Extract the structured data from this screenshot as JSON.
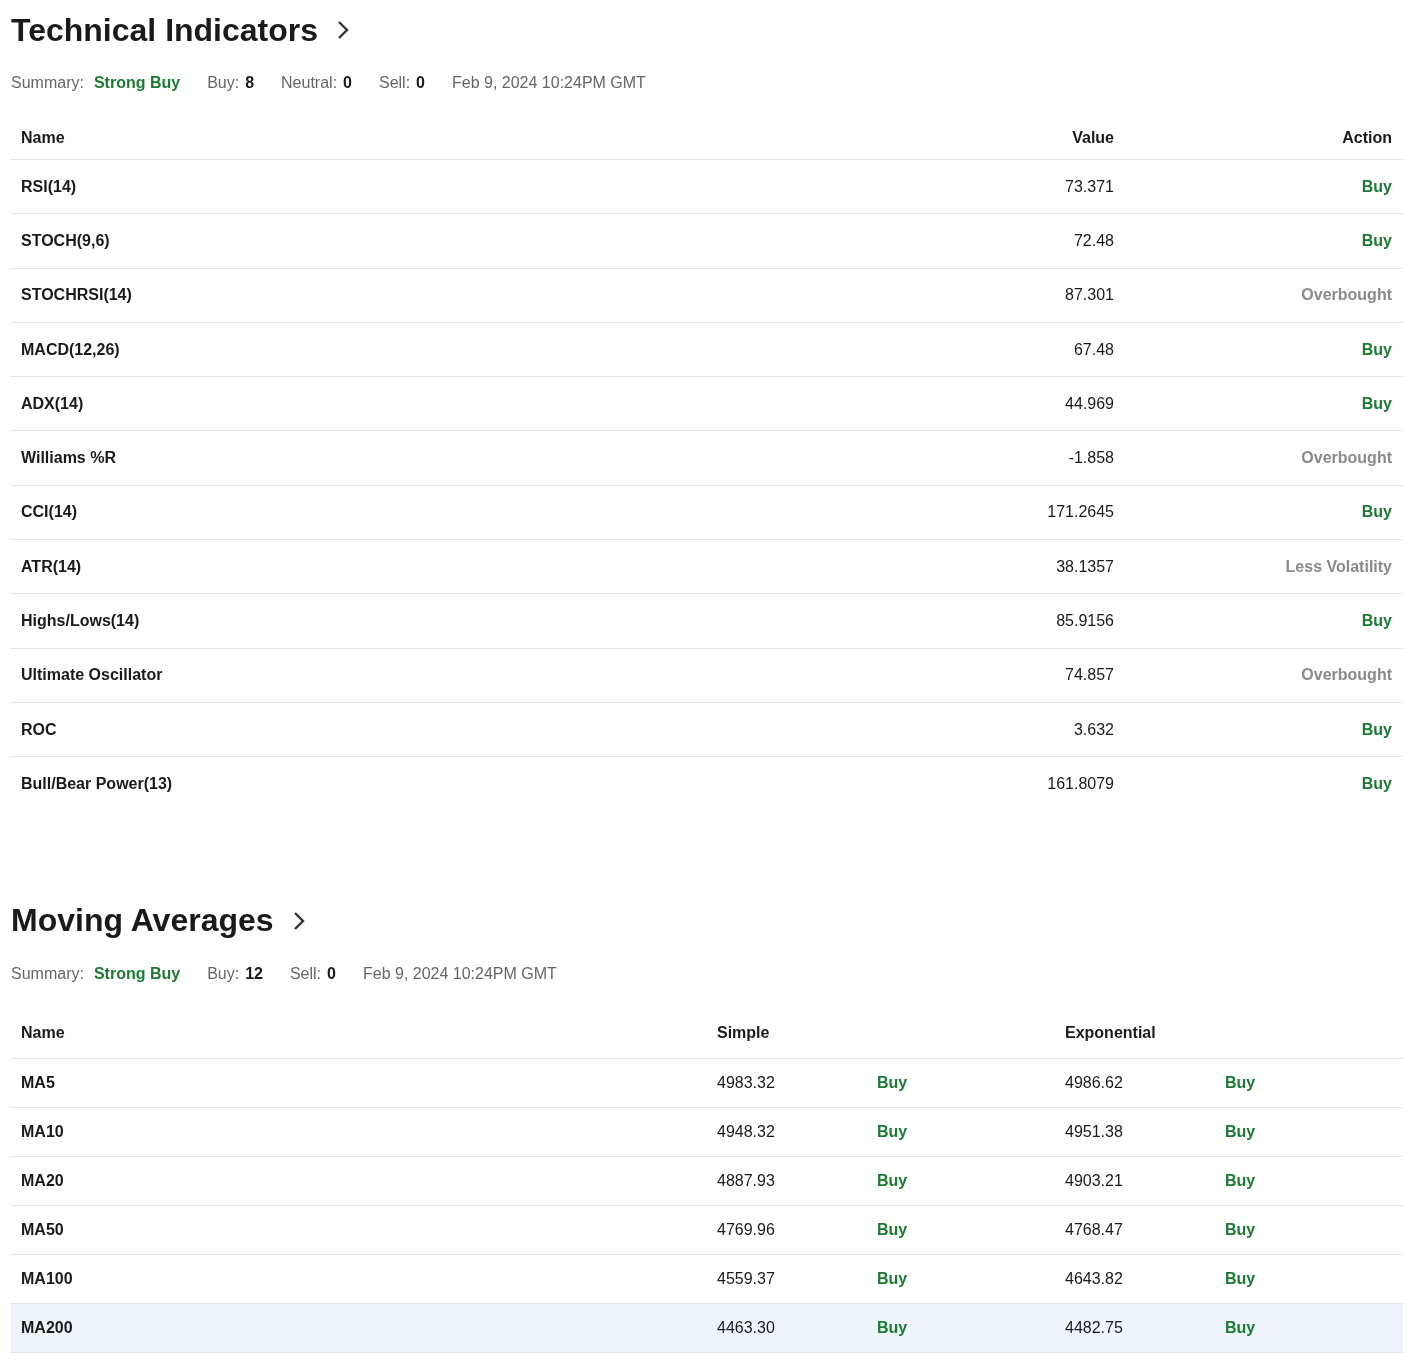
{
  "technical": {
    "title": "Technical Indicators",
    "summary": {
      "label": "Summary:",
      "verdict": "Strong Buy",
      "counts": [
        {
          "label": "Buy:",
          "value": "8"
        },
        {
          "label": "Neutral:",
          "value": "0"
        },
        {
          "label": "Sell:",
          "value": "0"
        }
      ],
      "time": "Feb 9, 2024 10:24PM GMT"
    },
    "columns": [
      "Name",
      "Value",
      "Action"
    ],
    "rows": [
      {
        "name": "RSI(14)",
        "value": "73.371",
        "action": "Buy",
        "color": "#1b7a34"
      },
      {
        "name": "STOCH(9,6)",
        "value": "72.48",
        "action": "Buy",
        "color": "#1b7a34"
      },
      {
        "name": "STOCHRSI(14)",
        "value": "87.301",
        "action": "Overbought",
        "color": "#8a8a8a"
      },
      {
        "name": "MACD(12,26)",
        "value": "67.48",
        "action": "Buy",
        "color": "#1b7a34"
      },
      {
        "name": "ADX(14)",
        "value": "44.969",
        "action": "Buy",
        "color": "#1b7a34"
      },
      {
        "name": "Williams %R",
        "value": "-1.858",
        "action": "Overbought",
        "color": "#8a8a8a"
      },
      {
        "name": "CCI(14)",
        "value": "171.2645",
        "action": "Buy",
        "color": "#1b7a34"
      },
      {
        "name": "ATR(14)",
        "value": "38.1357",
        "action": "Less Volatility",
        "color": "#8a8a8a"
      },
      {
        "name": "Highs/Lows(14)",
        "value": "85.9156",
        "action": "Buy",
        "color": "#1b7a34"
      },
      {
        "name": "Ultimate Oscillator",
        "value": "74.857",
        "action": "Overbought",
        "color": "#8a8a8a"
      },
      {
        "name": "ROC",
        "value": "3.632",
        "action": "Buy",
        "color": "#1b7a34"
      },
      {
        "name": "Bull/Bear Power(13)",
        "value": "161.8079",
        "action": "Buy",
        "color": "#1b7a34"
      }
    ]
  },
  "moving": {
    "title": "Moving Averages",
    "summary": {
      "label": "Summary:",
      "verdict": "Strong Buy",
      "counts": [
        {
          "label": "Buy:",
          "value": "12"
        },
        {
          "label": "Sell:",
          "value": "0"
        }
      ],
      "time": "Feb 9, 2024 10:24PM GMT"
    },
    "columns": [
      "Name",
      "Simple",
      "Exponential"
    ],
    "rows": [
      {
        "name": "MA5",
        "simple": "4983.32",
        "simple_action": "Buy",
        "exponential": "4986.62",
        "exponential_action": "Buy",
        "selected": false
      },
      {
        "name": "MA10",
        "simple": "4948.32",
        "simple_action": "Buy",
        "exponential": "4951.38",
        "exponential_action": "Buy",
        "selected": false
      },
      {
        "name": "MA20",
        "simple": "4887.93",
        "simple_action": "Buy",
        "exponential": "4903.21",
        "exponential_action": "Buy",
        "selected": false
      },
      {
        "name": "MA50",
        "simple": "4769.96",
        "simple_action": "Buy",
        "exponential": "4768.47",
        "exponential_action": "Buy",
        "selected": false
      },
      {
        "name": "MA100",
        "simple": "4559.37",
        "simple_action": "Buy",
        "exponential": "4643.82",
        "exponential_action": "Buy",
        "selected": false
      },
      {
        "name": "MA200",
        "simple": "4463.30",
        "simple_action": "Buy",
        "exponential": "4482.75",
        "exponential_action": "Buy",
        "selected": true
      }
    ]
  }
}
